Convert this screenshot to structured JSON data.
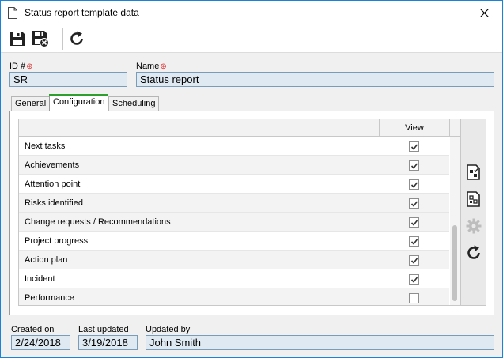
{
  "window": {
    "title": "Status report template data"
  },
  "form": {
    "id_label": "ID #",
    "id_value": "SR",
    "name_label": "Name",
    "name_value": "Status report"
  },
  "tabs": [
    {
      "label": "General",
      "active": false
    },
    {
      "label": "Configuration",
      "active": true
    },
    {
      "label": "Scheduling",
      "active": false
    }
  ],
  "grid": {
    "view_header": "View",
    "rows": [
      {
        "label": "Next tasks",
        "checked": true
      },
      {
        "label": "Achievements",
        "checked": true
      },
      {
        "label": "Attention point",
        "checked": true
      },
      {
        "label": "Risks identified",
        "checked": true
      },
      {
        "label": "Change requests / Recommendations",
        "checked": true
      },
      {
        "label": "Project progress",
        "checked": true
      },
      {
        "label": "Action plan",
        "checked": true
      },
      {
        "label": "Incident",
        "checked": true
      },
      {
        "label": "Performance",
        "checked": false
      }
    ]
  },
  "footer": {
    "created_label": "Created on",
    "created_value": "2/24/2018",
    "updated_label": "Last updated",
    "updated_value": "3/19/2018",
    "updated_by_label": "Updated by",
    "updated_by_value": "John Smith"
  },
  "icons": {
    "save": "save-icon",
    "save_close": "save-and-close-icon",
    "refresh": "refresh-icon"
  }
}
